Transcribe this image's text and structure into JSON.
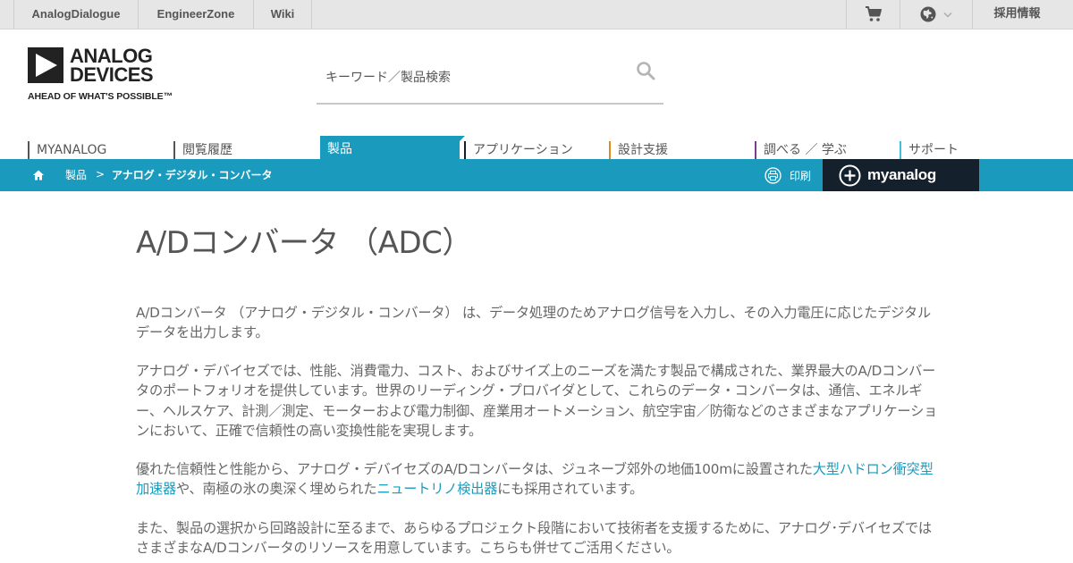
{
  "utility": {
    "links": [
      "AnalogDialogue",
      "EngineerZone",
      "Wiki"
    ],
    "careers": "採用情報"
  },
  "logo": {
    "word1": "ANALOG",
    "word2": "DEVICES",
    "tagline": "AHEAD OF WHAT'S POSSIBLE™"
  },
  "search": {
    "placeholder": "キーワード／製品検索"
  },
  "nav": {
    "items": [
      "MYANALOG",
      "閲覧履歴",
      "製品",
      "アプリケーション",
      "設計支援",
      "調べる ／ 学ぶ",
      "サポート"
    ],
    "active": "製品"
  },
  "breadcrumb": {
    "items": [
      "製品",
      "アナログ・デジタル・コンバータ"
    ],
    "separator": ">"
  },
  "print_label": "印刷",
  "myanalog_label": "myanalog",
  "page": {
    "title": "A/Dコンバータ （ADC）",
    "p1": "A/Dコンバータ （アナログ・デジタル・コンバータ） は、データ処理のためアナログ信号を入力し、その入力電圧に応じたデジタルデータを出力します。",
    "p2": "アナログ・デバイセズでは、性能、消費電力、コスト、およびサイズ上のニーズを満たす製品で構成された、業界最大のA/Dコンバータのポートフォリオを提供しています。世界のリーディング・プロバイダとして、これらのデータ・コンバータは、通信、エネルギー、ヘルスケア、計測／測定、モーターおよび電力制御、産業用オートメーション、航空宇宙／防衛などのさまざまなアプリケーションにおいて、正確で信頼性の高い変換性能を実現します。",
    "p3_pre": "優れた信頼性と性能から、アナログ・デバイセズのA/Dコンバータは、ジュネーブ郊外の地価100mに設置された",
    "p3_link1": "大型ハドロン衝突型加速器",
    "p3_mid": "や、南極の氷の奥深く埋められた",
    "p3_link2": "ニュートリノ検出器",
    "p3_post": "にも採用されています。",
    "p4": "また、製品の選択から回路設計に至るまで、あらゆるプロジェクト段階において技術者を支援するために、アナログ･デバイセズではさまざまなA/Dコンバータのリソースを用意しています。こちらも併せてご活用ください。"
  },
  "colors": {
    "accent": "#1a9bbd",
    "dark": "#14202c",
    "utility_bg": "#e6e6e6"
  }
}
